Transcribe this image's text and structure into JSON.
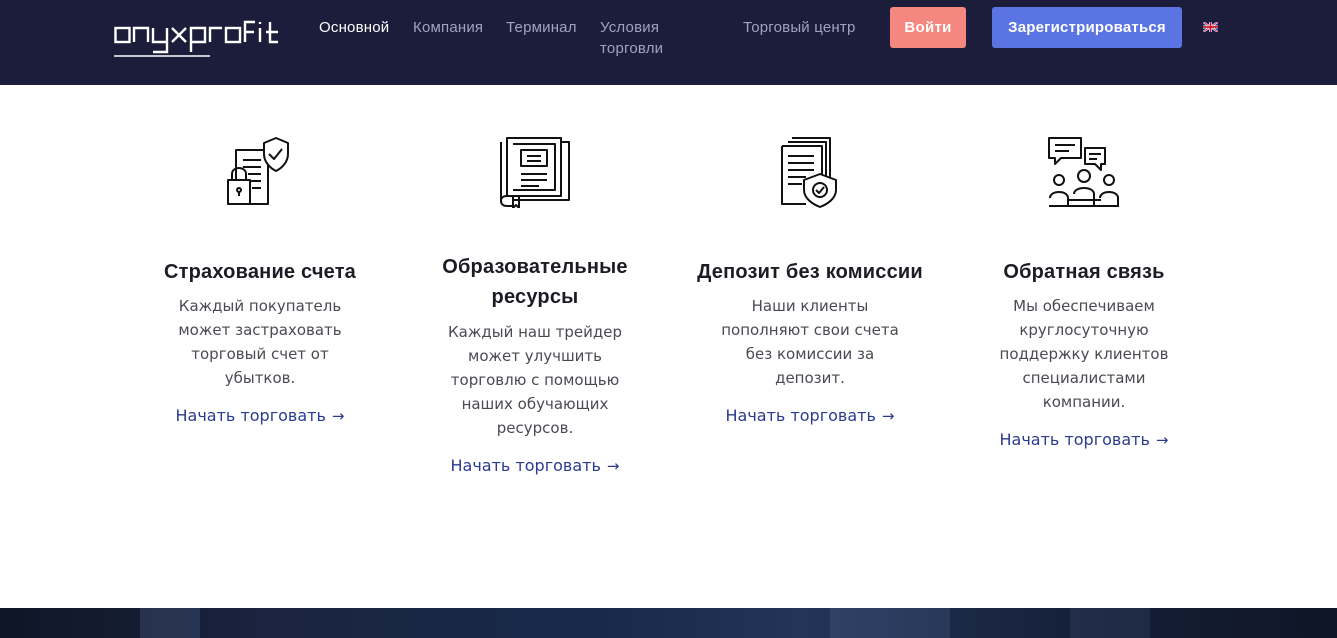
{
  "header": {
    "logo_text": "onyxprofit",
    "nav": [
      {
        "label": "Основной",
        "active": true
      },
      {
        "label": "Компания",
        "active": false
      },
      {
        "label": "Терминал",
        "active": false
      },
      {
        "label": "Условия торговли",
        "active": false
      },
      {
        "label": "Торговый центр",
        "active": false
      }
    ],
    "login_label": "Войти",
    "register_label": "Зарегистрироваться",
    "language_icon": "uk-flag-icon"
  },
  "features": [
    {
      "icon": "secure-document-icon",
      "title": "Страхование счета",
      "text": "Каждый покупатель может застраховать торговый счет от убытков.",
      "link": "Начать торговать"
    },
    {
      "icon": "book-icon",
      "title": "Образовательные ресурсы",
      "text": "Каждый наш трейдер может улучшить торговлю с помощью наших обучающих ресурсов.",
      "link": "Начать торговать"
    },
    {
      "icon": "documents-shield-icon",
      "title": "Депозит без комиссии",
      "text": "Наши клиенты пополняют свои счета без комиссии за депозит.",
      "link": "Начать торговать"
    },
    {
      "icon": "support-team-icon",
      "title": "Обратная связь",
      "text": "Мы обеспечиваем круглосуточную поддержку клиентов специалистами компании.",
      "link": "Начать торговать"
    }
  ],
  "colors": {
    "header_bg": "#1b1d3a",
    "login_bg": "#f4877f",
    "register_bg": "#5b74e4",
    "link": "#2a3b8f"
  }
}
